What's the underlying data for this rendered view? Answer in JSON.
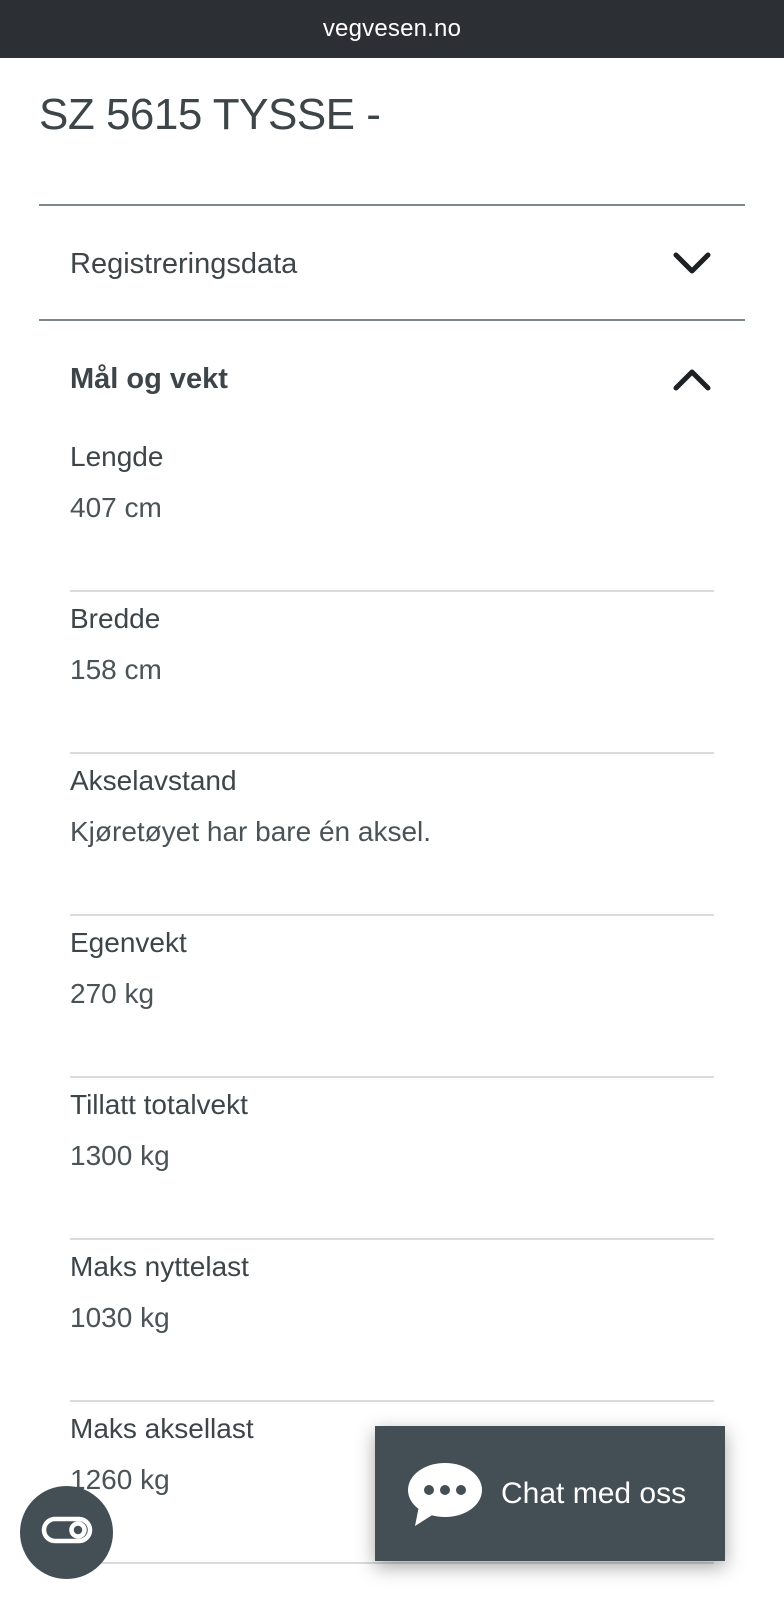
{
  "browser": {
    "domain": "vegvesen.no"
  },
  "page": {
    "title": "SZ 5615 TYSSE -"
  },
  "sections": [
    {
      "label": "Registreringsdata",
      "expanded": false,
      "icon": "chevron-down-icon"
    },
    {
      "label": "Mål og vekt",
      "expanded": true,
      "icon": "chevron-up-icon"
    }
  ],
  "dimensions": [
    {
      "label": "Lengde",
      "value": "407 cm"
    },
    {
      "label": "Bredde",
      "value": "158 cm"
    },
    {
      "label": "Akselavstand",
      "value": "Kjøretøyet har bare én aksel."
    },
    {
      "label": "Egenvekt",
      "value": "270 kg"
    },
    {
      "label": "Tillatt totalvekt",
      "value": "1300 kg"
    },
    {
      "label": "Maks nyttelast",
      "value": "1030 kg"
    },
    {
      "label": "Maks aksellast",
      "value": "1260 kg"
    }
  ],
  "chat": {
    "label": "Chat med oss",
    "icon": "chat-bubble-icon"
  },
  "accessibility": {
    "icon": "accessibility-toggle-icon"
  },
  "colors": {
    "topbar": "#2c2f33",
    "text": "#3d4549",
    "chat_background": "#444f55",
    "rule": "#7d8689"
  }
}
